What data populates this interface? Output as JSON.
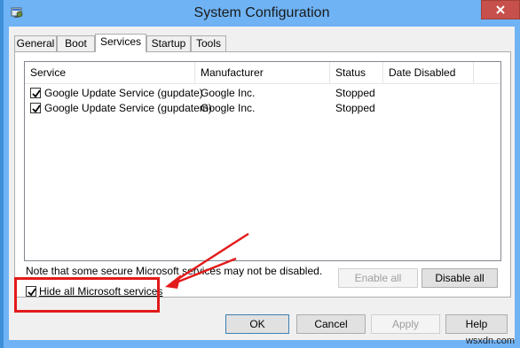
{
  "window": {
    "title": "System Configuration"
  },
  "tabs": [
    {
      "label": "General"
    },
    {
      "label": "Boot"
    },
    {
      "label": "Services",
      "active": true
    },
    {
      "label": "Startup"
    },
    {
      "label": "Tools"
    }
  ],
  "services": {
    "columns": [
      "Service",
      "Manufacturer",
      "Status",
      "Date Disabled"
    ],
    "rows": [
      {
        "checked": true,
        "service": "Google Update Service (gupdate)",
        "manufacturer": "Google Inc.",
        "status": "Stopped",
        "date_disabled": ""
      },
      {
        "checked": true,
        "service": "Google Update Service (gupdatem)",
        "manufacturer": "Google Inc.",
        "status": "Stopped",
        "date_disabled": ""
      }
    ],
    "note": "Note that some secure Microsoft services may not be disabled.",
    "enable_all_label": "Enable all",
    "disable_all_label": "Disable all",
    "hide_ms_label": "Hide all Microsoft services",
    "hide_ms_checked": true
  },
  "buttons": {
    "ok": "OK",
    "cancel": "Cancel",
    "apply": "Apply",
    "help": "Help"
  },
  "annotation": {
    "highlight_color": "#e31a1a"
  },
  "watermark": "wsxdn.com",
  "icons": {
    "app": "msconfig-icon",
    "close": "close-icon",
    "checkmark": "checkmark-icon"
  }
}
